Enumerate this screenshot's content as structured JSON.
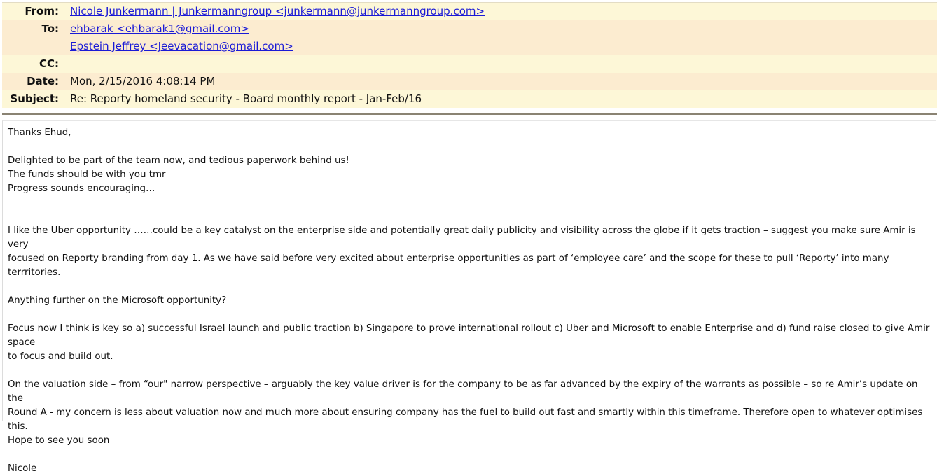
{
  "header": {
    "from": {
      "label": "From:",
      "value": "Nicole Junkermann | Junkermanngroup <junkermann@junkermanngroup.com>"
    },
    "to": {
      "label": "To:",
      "values": [
        "ehbarak <ehbarak1@gmail.com>",
        "Epstein Jeffrey <Jeevacation@gmail.com>"
      ]
    },
    "cc": {
      "label": "CC:",
      "value": ""
    },
    "date": {
      "label": "Date:",
      "value": "Mon, 2/15/2016 4:08:14 PM"
    },
    "subject": {
      "label": "Subject:",
      "value": "Re: Reporty homeland security - Board monthly report - Jan-Feb/16"
    }
  },
  "body": {
    "greeting": "Thanks Ehud,",
    "p1_line1": "Delighted to be part of the team now, and tedious paperwork behind us!",
    "p1_line2": "The funds should be with you tmr",
    "p1_line3": "Progress sounds encouraging…",
    "p2_line1": "I like the Uber opportunity ……could be a key catalyst on the enterprise side and potentially great daily publicity and visibility across the globe if it gets traction – suggest you make sure Amir is very",
    "p2_line2": "focused on Reporty branding from day 1. As we have said before very excited about enterprise opportunities as part of ‘employee care’ and the scope for these to pull ‘Reporty’ into many terrritories.",
    "p3": "Anything further on the Microsoft opportunity?",
    "p4_line1": "Focus now I think is key so a) successful Israel launch and public traction b) Singapore to prove international rollout c) Uber and Microsoft to enable Enterprise and d) fund raise closed to give Amir space",
    "p4_line2": "to focus and build out.",
    "p5_line1": "On the valuation side – from “our\" narrow perspective – arguably the key value driver is for the company to be as far advanced by the expiry of the warrants as possible –  so re Amir’s update on the",
    "p5_line2": "Round A - my concern is less about valuation now and much more about ensuring company has the fuel to build out fast and smartly within this timeframe.  Therefore open to whatever optimises this.",
    "p5_line3": "Hope to see you soon",
    "signature": "Nicole"
  }
}
